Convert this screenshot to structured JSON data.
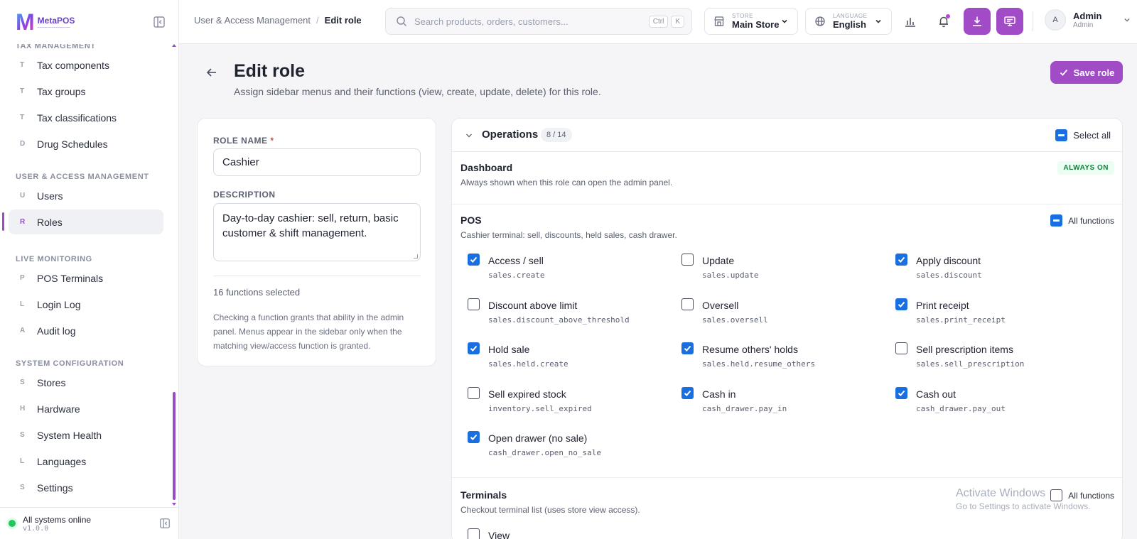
{
  "sidebar": {
    "logo_name": "MetaPOS",
    "sections": [
      {
        "title": "Tax Management",
        "items": [
          {
            "letter": "T",
            "label": "Tax components"
          },
          {
            "letter": "T",
            "label": "Tax groups"
          },
          {
            "letter": "T",
            "label": "Tax classifications"
          },
          {
            "letter": "D",
            "label": "Drug Schedules"
          }
        ]
      },
      {
        "title": "User & Access Management",
        "items": [
          {
            "letter": "U",
            "label": "Users"
          },
          {
            "letter": "R",
            "label": "Roles"
          }
        ]
      },
      {
        "title": "Live Monitoring",
        "items": [
          {
            "letter": "P",
            "label": "POS Terminals"
          },
          {
            "letter": "L",
            "label": "Login Log"
          },
          {
            "letter": "A",
            "label": "Audit log"
          }
        ]
      },
      {
        "title": "System Configuration",
        "items": [
          {
            "letter": "S",
            "label": "Stores"
          },
          {
            "letter": "H",
            "label": "Hardware"
          },
          {
            "letter": "S",
            "label": "System Health"
          },
          {
            "letter": "L",
            "label": "Languages"
          },
          {
            "letter": "S",
            "label": "Settings"
          }
        ]
      }
    ],
    "status": {
      "text": "All systems online",
      "version": "v1.0.0"
    }
  },
  "topbar": {
    "breadcrumb": {
      "parent": "User & Access Management",
      "sep": "/",
      "current": "Edit role"
    },
    "search": {
      "placeholder": "Search products, orders, customers...",
      "kbd1": "Ctrl",
      "kbd2": "K"
    },
    "store": {
      "label": "STORE",
      "value": "Main Store"
    },
    "language": {
      "label": "LANGUAGE",
      "value": "English"
    },
    "user": {
      "initial": "A",
      "name": "Admin",
      "role": "Admin"
    }
  },
  "page": {
    "title": "Edit role",
    "subtitle": "Assign sidebar menus and their functions (view, create, update, delete) for this role.",
    "save_label": "Save role"
  },
  "role_form": {
    "name_label": "ROLE NAME",
    "required_mark": "*",
    "name_value": "Cashier",
    "desc_label": "DESCRIPTION",
    "desc_value": "Day-to-day cashier: sell, return, basic customer & shift management.",
    "selected_count": "16 functions selected",
    "help": "Checking a function grants that ability in the admin panel. Menus appear in the sidebar only when the matching view/access function is granted."
  },
  "permissions": {
    "group_title": "Operations",
    "group_count": "8 / 14",
    "select_all_label": "Select all",
    "dashboard": {
      "title": "Dashboard",
      "desc": "Always shown when this role can open the admin panel.",
      "badge": "ALWAYS ON"
    },
    "pos": {
      "title": "POS",
      "desc": "Cashier terminal: sell, discounts, held sales, cash drawer.",
      "all_label": "All functions",
      "items": [
        {
          "name": "Access / sell",
          "code": "sales.create",
          "checked": true
        },
        {
          "name": "Update",
          "code": "sales.update",
          "checked": false
        },
        {
          "name": "Apply discount",
          "code": "sales.discount",
          "checked": true
        },
        {
          "name": "Discount above limit",
          "code": "sales.discount_above_threshold",
          "checked": false
        },
        {
          "name": "Oversell",
          "code": "sales.oversell",
          "checked": false
        },
        {
          "name": "Print receipt",
          "code": "sales.print_receipt",
          "checked": true
        },
        {
          "name": "Hold sale",
          "code": "sales.held.create",
          "checked": true
        },
        {
          "name": "Resume others' holds",
          "code": "sales.held.resume_others",
          "checked": true
        },
        {
          "name": "Sell prescription items",
          "code": "sales.sell_prescription",
          "checked": false
        },
        {
          "name": "Sell expired stock",
          "code": "inventory.sell_expired",
          "checked": false
        },
        {
          "name": "Cash in",
          "code": "cash_drawer.pay_in",
          "checked": true
        },
        {
          "name": "Cash out",
          "code": "cash_drawer.pay_out",
          "checked": true
        },
        {
          "name": "Open drawer (no sale)",
          "code": "cash_drawer.open_no_sale",
          "checked": true
        }
      ]
    },
    "terminals": {
      "title": "Terminals",
      "desc": "Checkout terminal list (uses store view access).",
      "all_label": "All functions",
      "items": [
        {
          "name": "View",
          "checked": false
        }
      ]
    }
  },
  "watermark": {
    "line1": "Activate Windows",
    "line2": "Go to Settings to activate Windows."
  }
}
